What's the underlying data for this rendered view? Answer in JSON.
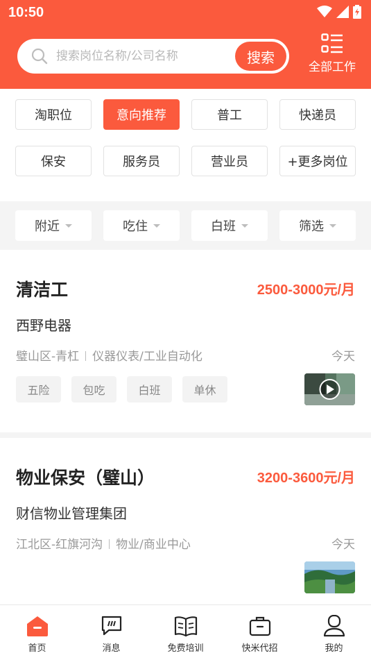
{
  "status_bar": {
    "time": "10:50"
  },
  "search": {
    "placeholder": "搜索岗位名称/公司名称",
    "button_label": "搜索"
  },
  "all_jobs": {
    "label": "全部工作"
  },
  "categories": [
    {
      "label": "淘职位",
      "active": false
    },
    {
      "label": "意向推荐",
      "active": true
    },
    {
      "label": "普工",
      "active": false
    },
    {
      "label": "快递员",
      "active": false
    },
    {
      "label": "保安",
      "active": false
    },
    {
      "label": "服务员",
      "active": false
    },
    {
      "label": "营业员",
      "active": false
    },
    {
      "label": "+更多岗位",
      "active": false
    }
  ],
  "filters": [
    {
      "label": "附近"
    },
    {
      "label": "吃住"
    },
    {
      "label": "白班"
    },
    {
      "label": "筛选"
    }
  ],
  "jobs": [
    {
      "title": "清洁工",
      "salary": "2500-3000元/月",
      "company": "西野电器",
      "location": "璧山区-青杠",
      "industry": "仪器仪表/工业自动化",
      "posted": "今天",
      "benefits": [
        "五险",
        "包吃",
        "白班",
        "单休"
      ],
      "thumbnail": "video-thumbnail"
    },
    {
      "title": "物业保安（璧山）",
      "salary": "3200-3600元/月",
      "company": "财信物业管理集团",
      "location": "江北区-红旗河沟",
      "industry": "物业/商业中心",
      "posted": "今天",
      "benefits": [],
      "thumbnail": "image-thumbnail"
    }
  ],
  "bottom_nav": [
    {
      "label": "首页",
      "icon": "home-icon",
      "active": true
    },
    {
      "label": "消息",
      "icon": "message-icon",
      "active": false
    },
    {
      "label": "免费培训",
      "icon": "book-icon",
      "active": false
    },
    {
      "label": "快米代招",
      "icon": "briefcase-icon",
      "active": false
    },
    {
      "label": "我的",
      "icon": "profile-icon",
      "active": false
    }
  ],
  "colors": {
    "brand": "#fb5a3d",
    "muted_bg": "#f4f4f4",
    "muted_text": "#999999"
  }
}
